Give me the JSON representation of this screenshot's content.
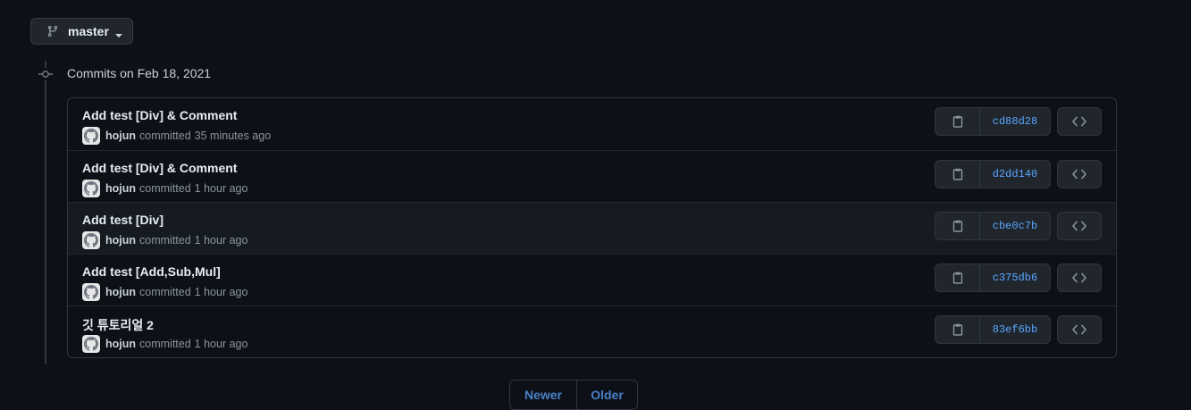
{
  "branch": {
    "name": "master",
    "icon": "git-branch-icon"
  },
  "group": {
    "title": "Commits on Feb 18, 2021",
    "icon": "git-commit-icon"
  },
  "commits": [
    {
      "title": "Add test [Div] & Comment",
      "author": "hojun",
      "verb": "committed",
      "time": "35 minutes ago",
      "sha": "cd88d28"
    },
    {
      "title": "Add test [Div] & Comment",
      "author": "hojun",
      "verb": "committed",
      "time": "1 hour ago",
      "sha": "d2dd140"
    },
    {
      "title": "Add test [Div]",
      "author": "hojun",
      "verb": "committed",
      "time": "1 hour ago",
      "sha": "cbe0c7b"
    },
    {
      "title": "Add test [Add,Sub,Mul]",
      "author": "hojun",
      "verb": "committed",
      "time": "1 hour ago",
      "sha": "c375db6"
    },
    {
      "title": "깃 튜토리얼 2",
      "author": "hojun",
      "verb": "committed",
      "time": "1 hour ago",
      "sha": "83ef6bb"
    }
  ],
  "pagination": {
    "newer": "Newer",
    "older": "Older"
  },
  "colors": {
    "background": "#0d1117",
    "sha_link": "#58a6ff",
    "pagination_link": "#4b7fc6"
  }
}
